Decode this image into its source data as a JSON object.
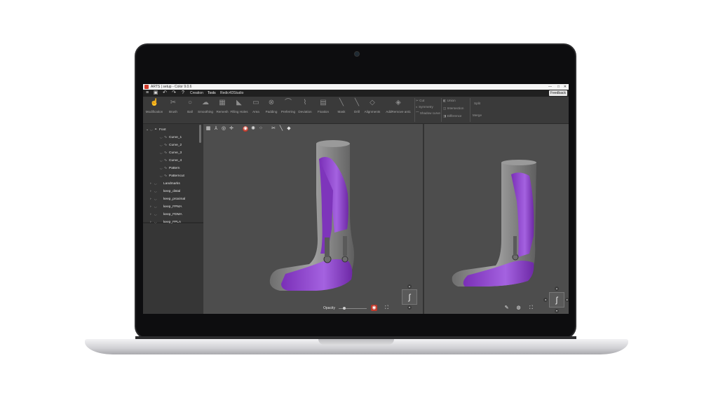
{
  "window": {
    "title": "ARTS | setup - Color 9.0.6",
    "controls": [
      "—",
      "□",
      "✕"
    ]
  },
  "menubar": {
    "icons": [
      "hamburger-icon",
      "save-icon",
      "undo-icon",
      "redo-icon",
      "help-icon"
    ],
    "tabs": [
      "Creation",
      "Tools",
      "Redic4DStudio"
    ],
    "active_tab": "Tools",
    "feedback_label": "Feedback"
  },
  "ribbon": {
    "buttons": [
      {
        "label": "Modification",
        "icon": "☝"
      },
      {
        "label": "Brush",
        "icon": "✂"
      },
      {
        "label": "Ball",
        "icon": "○"
      },
      {
        "label": "Smoothing",
        "icon": "☁"
      },
      {
        "label": "Remesh",
        "icon": "▦"
      },
      {
        "label": "Filling Holes",
        "icon": "◣"
      },
      {
        "label": "Area",
        "icon": "▭"
      },
      {
        "label": "Padding",
        "icon": "⊗"
      },
      {
        "label": "Preferring",
        "icon": "⌒"
      },
      {
        "label": "Deviation",
        "icon": "⌇"
      },
      {
        "label": "Fixation",
        "icon": "▤"
      },
      {
        "label": "Mask",
        "icon": "╲"
      },
      {
        "label": "Drill",
        "icon": "╲"
      },
      {
        "label": "Alignments",
        "icon": "◇"
      },
      {
        "label": "AddRemove ant1",
        "icon": "◈"
      }
    ],
    "small_group_1": [
      "Cut",
      "Symmetry",
      "Shadow curve"
    ],
    "small_group_2": [
      "Union",
      "Intersection",
      "Difference"
    ],
    "small_group_3": [
      "Split",
      "Merge"
    ]
  },
  "tree": {
    "items": [
      {
        "label": "Foot",
        "level": 0,
        "expanded": true
      },
      {
        "label": "Curve_1",
        "level": 2
      },
      {
        "label": "Curve_2",
        "level": 2
      },
      {
        "label": "Curve_3",
        "level": 2
      },
      {
        "label": "Curve_4",
        "level": 2
      },
      {
        "label": "Pattern",
        "level": 2
      },
      {
        "label": "Patterncut",
        "level": 2
      },
      {
        "label": "Landmarks",
        "level": 1
      },
      {
        "label": "keep_distal",
        "level": 1
      },
      {
        "label": "keep_proximal",
        "level": 1
      },
      {
        "label": "keep_FPMA",
        "level": 1
      },
      {
        "label": "keep_FDMA",
        "level": 1
      },
      {
        "label": "keep_FPLA",
        "level": 1
      }
    ]
  },
  "viewport": {
    "opacity_label": "Opacity",
    "opacity": 0.2,
    "toolbar_icons": [
      "grid-icon",
      "axes-icon",
      "target-icon",
      "crosshair-icon",
      "sphere-icon",
      "gear-icon",
      "dots-icon",
      "scissors-icon",
      "pen-icon",
      "fill-icon"
    ],
    "model_colors": {
      "shell": "#8a8a8a",
      "orthosis": "#8b3fc6",
      "orthosis_light": "#b275e8"
    }
  }
}
